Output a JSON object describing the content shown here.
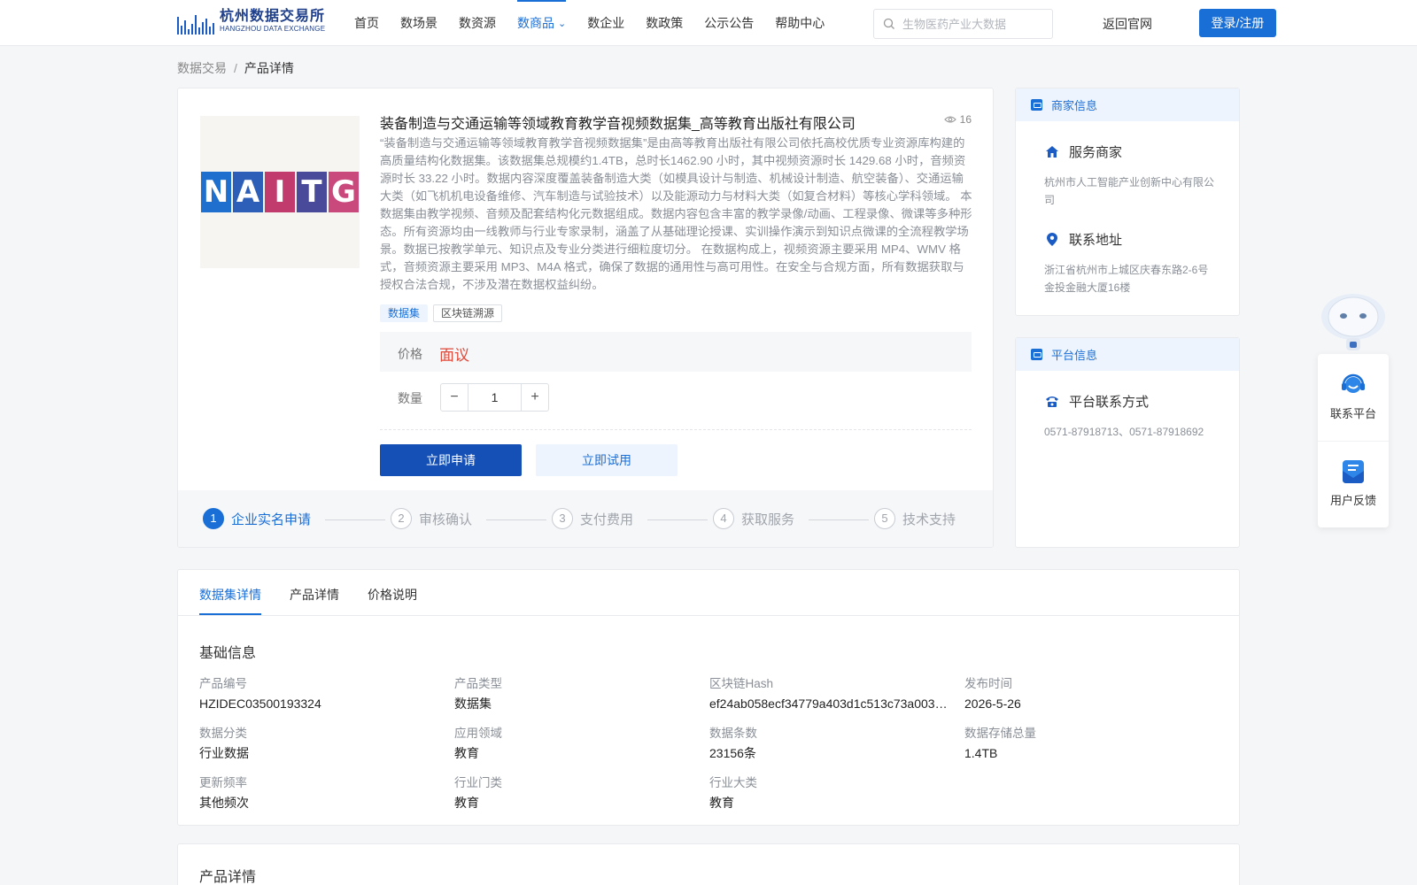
{
  "header": {
    "logo_cn": "杭州数据交易所",
    "logo_en": "HANGZHOU DATA EXCHANGE",
    "nav": [
      "首页",
      "数场景",
      "数资源",
      "数商品",
      "数企业",
      "数政策",
      "公示公告",
      "帮助中心"
    ],
    "active_nav": "数商品",
    "search_placeholder": "生物医药产业大数据",
    "back_link": "返回官网",
    "login": "登录/注册",
    "accent": "#1a6fd6"
  },
  "breadcrumb": {
    "root": "数据交易",
    "sep": "/",
    "current": "产品详情"
  },
  "product": {
    "thumb_letters": [
      "N",
      "A",
      "I",
      "T",
      "G"
    ],
    "thumb_colors": [
      "#1f6fcf",
      "#2e5fb8",
      "#c23b6d",
      "#4a4a9a",
      "#c9497d"
    ],
    "title": "装备制造与交通运输等领域教育教学音视频数据集_高等教育出版社有限公司",
    "views": "16",
    "description": "“装备制造与交通运输等领域教育教学音视频数据集”是由高等教育出版社有限公司依托高校优质专业资源库构建的高质量结构化数据集。该数据集总规模约1.4TB，总时长1462.90 小时，其中视频资源时长 1429.68 小时，音频资源时长 33.22 小时。数据内容深度覆盖装备制造大类（如模具设计与制造、机械设计制造、航空装备）、交通运输大类（如飞机机电设备维修、汽车制造与试验技术）以及能源动力与材料大类（如复合材料）等核心学科领域。 本数据集由教学视频、音频及配套结构化元数据组成。数据内容包含丰富的教学录像/动画、工程录像、微课等多种形态。所有资源均由一线教师与行业专家录制，涵盖了从基础理论授课、实训操作演示到知识点微课的全流程教学场景。数据已按教学单元、知识点及专业分类进行细粒度切分。 在数据构成上，视频资源主要采用 MP4、WMV 格式，音频资源主要采用 MP3、M4A 格式，确保了数据的通用性与高可用性。在安全与合规方面，所有数据获取与授权合法合规，不涉及潜在数据权益纠纷。",
    "tags": [
      "数据集",
      "区块链溯源"
    ],
    "price_label": "价格",
    "price_value": "面议",
    "qty_label": "数量",
    "qty_minus": "−",
    "qty_value": "1",
    "qty_plus": "+",
    "apply": "立即申请",
    "trial": "立即试用"
  },
  "steps": [
    {
      "num": "1",
      "label": "企业实名申请",
      "active": true
    },
    {
      "num": "2",
      "label": "审核确认",
      "active": false
    },
    {
      "num": "3",
      "label": "支付费用",
      "active": false
    },
    {
      "num": "4",
      "label": "获取服务",
      "active": false
    },
    {
      "num": "5",
      "label": "技术支持",
      "active": false
    }
  ],
  "merchant": {
    "title": "商家信息",
    "service_title": "服务商家",
    "service_value": "杭州市人工智能产业创新中心有限公司",
    "address_title": "联系地址",
    "address_value": "浙江省杭州市上城区庆春东路2-6号金投金融大厦16楼"
  },
  "platform": {
    "title": "平台信息",
    "contact_title": "平台联系方式",
    "contact_value": "0571-87918713、0571-87918692"
  },
  "float": {
    "contact": "联系平台",
    "feedback": "用户反馈"
  },
  "tabs": [
    "数据集详情",
    "产品详情",
    "价格说明"
  ],
  "basic": {
    "title": "基础信息",
    "fields": [
      {
        "k": "产品编号",
        "v": "HZIDEC03500193324"
      },
      {
        "k": "产品类型",
        "v": "数据集"
      },
      {
        "k": "区块链Hash",
        "v": "ef24ab058ecf34779a403d1c513c73a0036…"
      },
      {
        "k": "发布时间",
        "v": "2026-5-26"
      },
      {
        "k": "数据分类",
        "v": "行业数据"
      },
      {
        "k": "应用领域",
        "v": "教育"
      },
      {
        "k": "数据条数",
        "v": "23156条"
      },
      {
        "k": "数据存储总量",
        "v": "1.4TB"
      },
      {
        "k": "更新频率",
        "v": "其他频次"
      },
      {
        "k": "行业门类",
        "v": "教育"
      },
      {
        "k": "行业大类",
        "v": "教育"
      }
    ]
  },
  "product_detail_title": "产品详情"
}
